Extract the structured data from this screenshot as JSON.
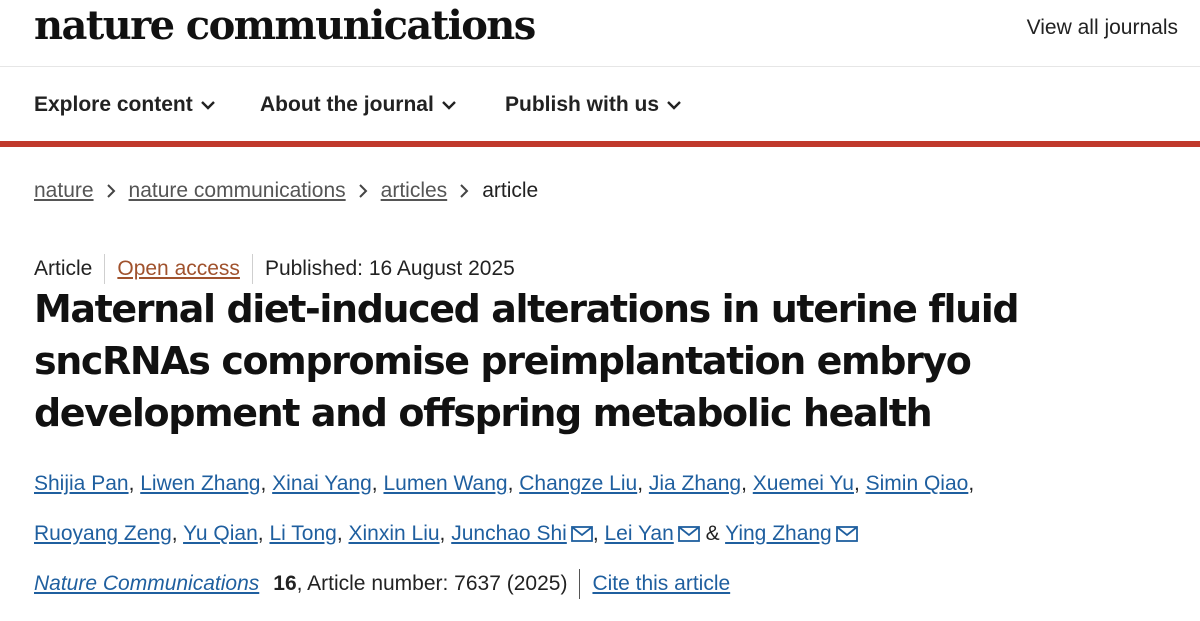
{
  "header": {
    "logo_text": "nature communications",
    "view_all": "View all journals"
  },
  "nav": {
    "items": [
      {
        "label": "Explore content"
      },
      {
        "label": "About the journal"
      },
      {
        "label": "Publish with us"
      }
    ]
  },
  "breadcrumb": {
    "items": [
      "nature",
      "nature communications",
      "articles"
    ],
    "current": "article"
  },
  "article": {
    "type": "Article",
    "access": "Open access",
    "published": "Published: 16 August 2025",
    "title_line1": "Maternal diet-induced alterations in uterine fluid",
    "title_line2": "sncRNAs compromise preimplantation embryo",
    "title_line3": "development and offspring metabolic health",
    "authors": [
      "Shijia Pan",
      "Liwen Zhang",
      "Xinai Yang",
      "Lumen Wang",
      "Changze Liu",
      "Jia Zhang",
      "Xuemei Yu",
      "Simin Qiao",
      "Ruoyang Zeng",
      "Yu Qian",
      "Li Tong",
      "Xinxin Liu",
      "Junchao Shi",
      "Lei Yan",
      "Ying Zhang"
    ],
    "authors_and": "&",
    "journal": "Nature Communications",
    "volume": "16",
    "article_number": ", Article number: 7637 (2025)",
    "cite": "Cite this article"
  },
  "colors": {
    "accent_rule": "#c0392b",
    "link": "#1f5f9f",
    "open_access": "#a0522d"
  },
  "icons": {
    "chevron": "chevron-down-icon",
    "breadcrumb_separator": "chevron-right-icon",
    "mail": "mail-icon"
  }
}
